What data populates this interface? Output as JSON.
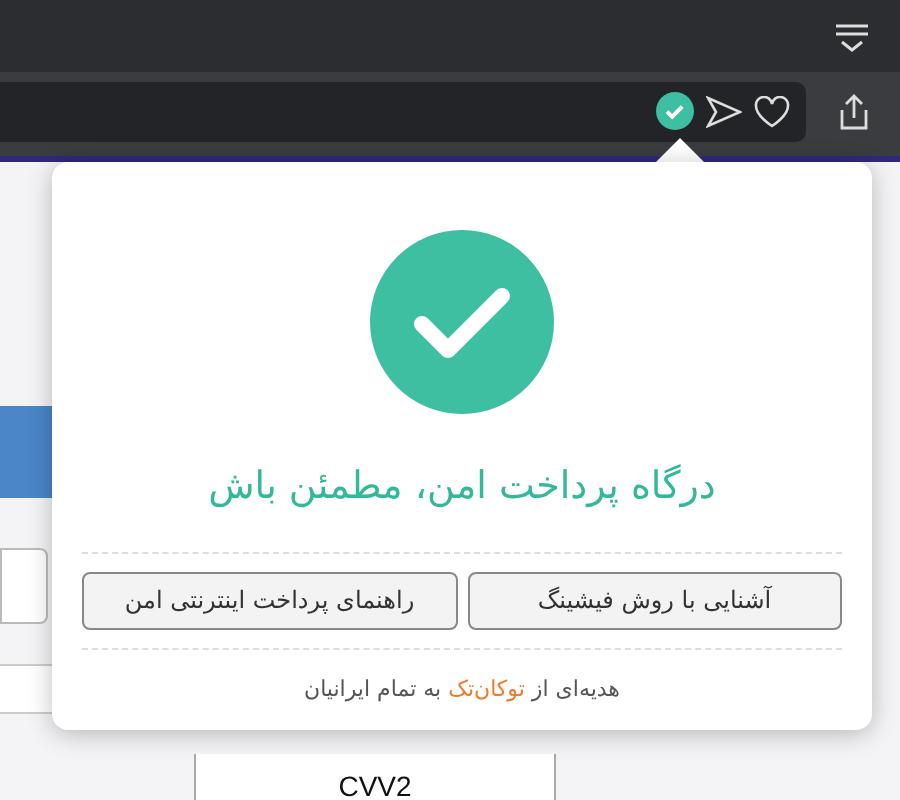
{
  "popup": {
    "title": "درگاه پرداخت امن، مطمئن باش",
    "buttons": [
      "آشنایی با روش فیشینگ",
      "راهنمای پرداخت اینترنتی امن"
    ],
    "footer": {
      "before": "هدیه‌ای از",
      "link": "توکان‌تک",
      "after": "به تمام ایرانیان"
    }
  },
  "page": {
    "field_label": "CVV2"
  }
}
